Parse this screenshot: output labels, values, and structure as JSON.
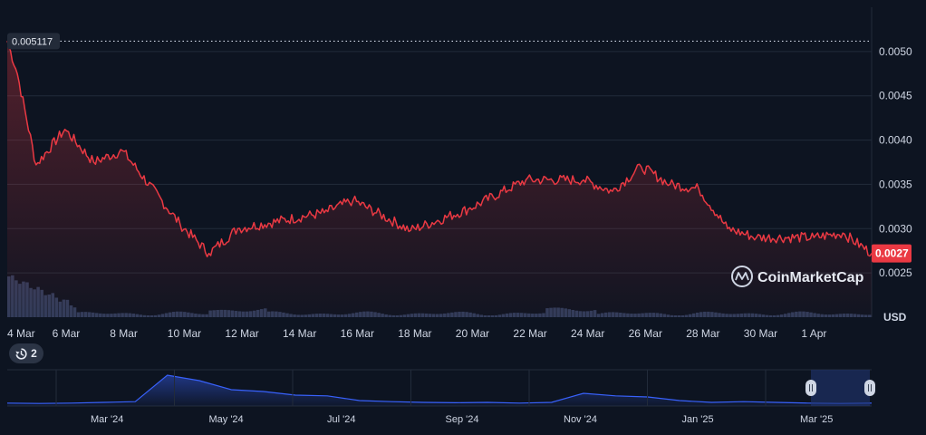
{
  "chart_data": {
    "type": "area",
    "currency": "USD",
    "watermark": "CoinMarketCap",
    "colors": {
      "line": "#ea3943",
      "current_price_bg": "#ea3943",
      "volume": "#2f3c5a",
      "navigator_line": "#3861fb",
      "background": "#0d1421",
      "grid": "#222b3a"
    },
    "y_axis": {
      "ticks": [
        "0.0025",
        "0.0030",
        "0.0035",
        "0.0040",
        "0.0045",
        "0.0050"
      ],
      "range": [
        0.002,
        0.0055
      ]
    },
    "x_axis_labels": [
      "4 Mar",
      "6 Mar",
      "8 Mar",
      "10 Mar",
      "12 Mar",
      "14 Mar",
      "16 Mar",
      "18 Mar",
      "20 Mar",
      "22 Mar",
      "24 Mar",
      "26 Mar",
      "28 Mar",
      "30 Mar",
      "1 Apr"
    ],
    "start_price_label": "0.005117",
    "start_price": 0.005117,
    "current_price_label": "0.0027",
    "current_price": 0.00272,
    "price_series": {
      "dates": [
        "4 Mar",
        "5 Mar",
        "6 Mar",
        "7 Mar",
        "8 Mar",
        "9 Mar",
        "10 Mar",
        "11 Mar",
        "12 Mar",
        "13 Mar",
        "14 Mar",
        "15 Mar",
        "16 Mar",
        "17 Mar",
        "18 Mar",
        "19 Mar",
        "20 Mar",
        "21 Mar",
        "22 Mar",
        "23 Mar",
        "24 Mar",
        "25 Mar",
        "26 Mar",
        "27 Mar",
        "28 Mar",
        "29 Mar",
        "30 Mar",
        "31 Mar",
        "1 Apr",
        "2 Apr",
        "3 Apr"
      ],
      "values": [
        0.00512,
        0.00395,
        0.00408,
        0.00378,
        0.00385,
        0.00345,
        0.00298,
        0.00285,
        0.00308,
        0.00312,
        0.00305,
        0.0032,
        0.00325,
        0.00315,
        0.0031,
        0.003,
        0.00318,
        0.00322,
        0.00318,
        0.00335,
        0.00335,
        0.00345,
        0.0035,
        0.00345,
        0.00345,
        0.00305,
        0.00295,
        0.0029,
        0.00287,
        0.0029,
        0.00272
      ],
      "key_points": [
        {
          "date": "4 Mar",
          "value": 0.00512
        },
        {
          "date": "4 Mar",
          "value": 0.00475
        },
        {
          "date": "5 Mar",
          "value": 0.00372
        },
        {
          "date": "6 Mar",
          "value": 0.00412
        },
        {
          "date": "7 Mar",
          "value": 0.00375
        },
        {
          "date": "8 Mar",
          "value": 0.00388
        },
        {
          "date": "10 Mar",
          "value": 0.00305
        },
        {
          "date": "11 Mar",
          "value": 0.00272
        },
        {
          "date": "12 Mar",
          "value": 0.003
        },
        {
          "date": "15 Mar",
          "value": 0.00318
        },
        {
          "date": "16 Mar",
          "value": 0.00332
        },
        {
          "date": "18 Mar",
          "value": 0.00298
        },
        {
          "date": "20 Mar",
          "value": 0.00322
        },
        {
          "date": "22 Mar",
          "value": 0.00355
        },
        {
          "date": "24 Mar",
          "value": 0.00355
        },
        {
          "date": "25 Mar",
          "value": 0.00342
        },
        {
          "date": "26 Mar",
          "value": 0.0037
        },
        {
          "date": "27 Mar",
          "value": 0.0035
        },
        {
          "date": "28 Mar",
          "value": 0.00345
        },
        {
          "date": "29 Mar",
          "value": 0.003
        },
        {
          "date": "30 Mar",
          "value": 0.0029
        },
        {
          "date": "1 Apr",
          "value": 0.0029
        },
        {
          "date": "2 Apr",
          "value": 0.00295
        },
        {
          "date": "3 Apr",
          "value": 0.00272
        }
      ]
    },
    "navigator": {
      "labels": [
        "Mar '24",
        "May '24",
        "Jul '24",
        "Sep '24",
        "Nov '24",
        "Jan '25",
        "Mar '25"
      ],
      "relative_values": [
        0.08,
        0.07,
        0.08,
        0.1,
        0.12,
        0.85,
        0.7,
        0.45,
        0.4,
        0.3,
        0.28,
        0.15,
        0.12,
        0.1,
        0.09,
        0.1,
        0.08,
        0.1,
        0.35,
        0.28,
        0.25,
        0.15,
        0.1,
        0.12,
        0.1,
        0.08,
        0.07,
        0.08
      ]
    },
    "history_badge": "2"
  }
}
